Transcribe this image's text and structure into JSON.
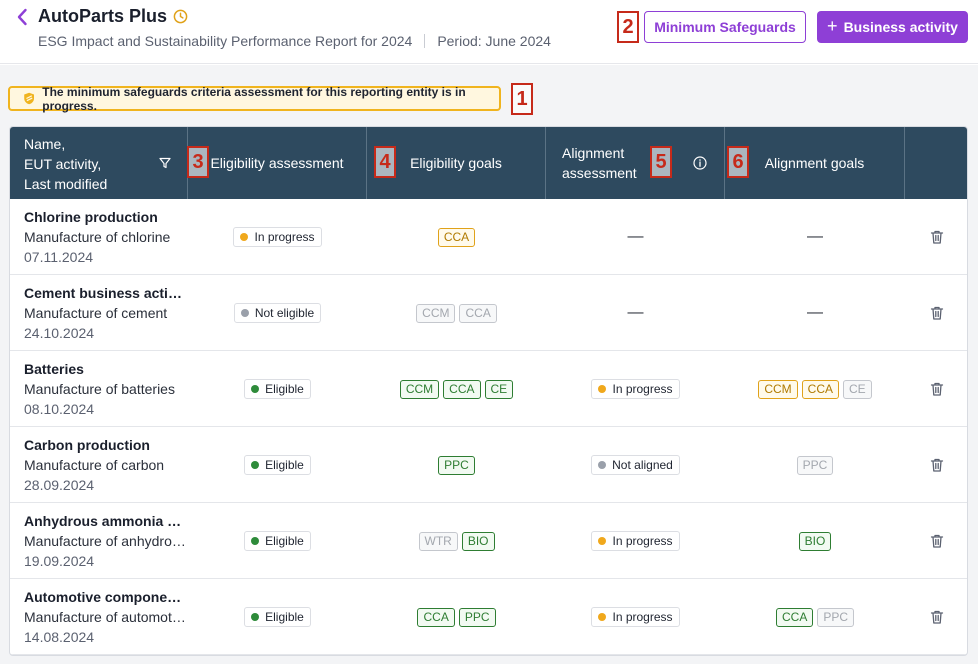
{
  "header": {
    "title": "AutoParts Plus",
    "subtitle": "ESG Impact and Sustainability Performance Report for 2024",
    "period": "Period: June 2024",
    "min_safeguards_label": "Minimum Safeguards",
    "business_activity_label": "Business activity"
  },
  "alert": {
    "text": "The minimum safeguards criteria assessment for this reporting entity is in progress."
  },
  "annotations": [
    "1",
    "2",
    "3",
    "4",
    "5",
    "6"
  ],
  "table": {
    "columns": {
      "name": [
        "Name,",
        "EUT activity,",
        "Last modified"
      ],
      "eligibility_assessment": "Eligibility assessment",
      "eligibility_goals": "Eligibility goals",
      "alignment_assessment": [
        "Alignment",
        "assessment"
      ],
      "alignment_goals": "Alignment goals"
    },
    "dash": "—",
    "rows": [
      {
        "name": "Chlorine production",
        "activity": "Manufacture of chlorine",
        "date": "07.11.2024",
        "elig_status": "In progress",
        "elig_status_color": "#f0a81c",
        "elig_goals": [
          {
            "label": "CCA",
            "style": "warn"
          }
        ],
        "align_status": "",
        "align_goals": []
      },
      {
        "name": "Cement business activity",
        "activity": "Manufacture of cement",
        "date": "24.10.2024",
        "elig_status": "Not eligible",
        "elig_status_color": "#9aa0aa",
        "elig_goals": [
          {
            "label": "CCM",
            "style": "muted"
          },
          {
            "label": "CCA",
            "style": "muted"
          }
        ],
        "align_status": "",
        "align_goals": []
      },
      {
        "name": "Batteries",
        "activity": "Manufacture of batteries",
        "date": "08.10.2024",
        "elig_status": "Eligible",
        "elig_status_color": "#2e8b3a",
        "elig_goals": [
          {
            "label": "CCM",
            "style": "ok"
          },
          {
            "label": "CCA",
            "style": "ok"
          },
          {
            "label": "CE",
            "style": "ok"
          }
        ],
        "align_status": "In progress",
        "align_status_color": "#f0a81c",
        "align_goals": [
          {
            "label": "CCM",
            "style": "warn"
          },
          {
            "label": "CCA",
            "style": "warn"
          },
          {
            "label": "CE",
            "style": "muted"
          }
        ]
      },
      {
        "name": "Carbon production",
        "activity": "Manufacture of carbon",
        "date": "28.09.2024",
        "elig_status": "Eligible",
        "elig_status_color": "#2e8b3a",
        "elig_goals": [
          {
            "label": "PPC",
            "style": "ok"
          }
        ],
        "align_status": "Not aligned",
        "align_status_color": "#9aa0aa",
        "align_goals": [
          {
            "label": "PPC",
            "style": "muted"
          }
        ]
      },
      {
        "name": "Anhydrous ammonia production",
        "activity": "Manufacture of anhydrous ammonia",
        "date": "19.09.2024",
        "elig_status": "Eligible",
        "elig_status_color": "#2e8b3a",
        "elig_goals": [
          {
            "label": "WTR",
            "style": "muted"
          },
          {
            "label": "BIO",
            "style": "ok"
          }
        ],
        "align_status": "In progress",
        "align_status_color": "#f0a81c",
        "align_goals": [
          {
            "label": "BIO",
            "style": "ok"
          }
        ]
      },
      {
        "name": "Automotive components",
        "activity": "Manufacture of automotive components",
        "date": "14.08.2024",
        "elig_status": "Eligible",
        "elig_status_color": "#2e8b3a",
        "elig_goals": [
          {
            "label": "CCA",
            "style": "ok"
          },
          {
            "label": "PPC",
            "style": "ok"
          }
        ],
        "align_status": "In progress",
        "align_status_color": "#f0a81c",
        "align_goals": [
          {
            "label": "CCA",
            "style": "ok"
          },
          {
            "label": "PPC",
            "style": "muted"
          }
        ]
      }
    ]
  },
  "colors": {
    "accent": "#8e3fd6",
    "table_header": "#2e4a5f",
    "goal_ok": "#2e7d32",
    "goal_warn": "#e0a21a",
    "goal_muted": "#c4c7cd"
  }
}
